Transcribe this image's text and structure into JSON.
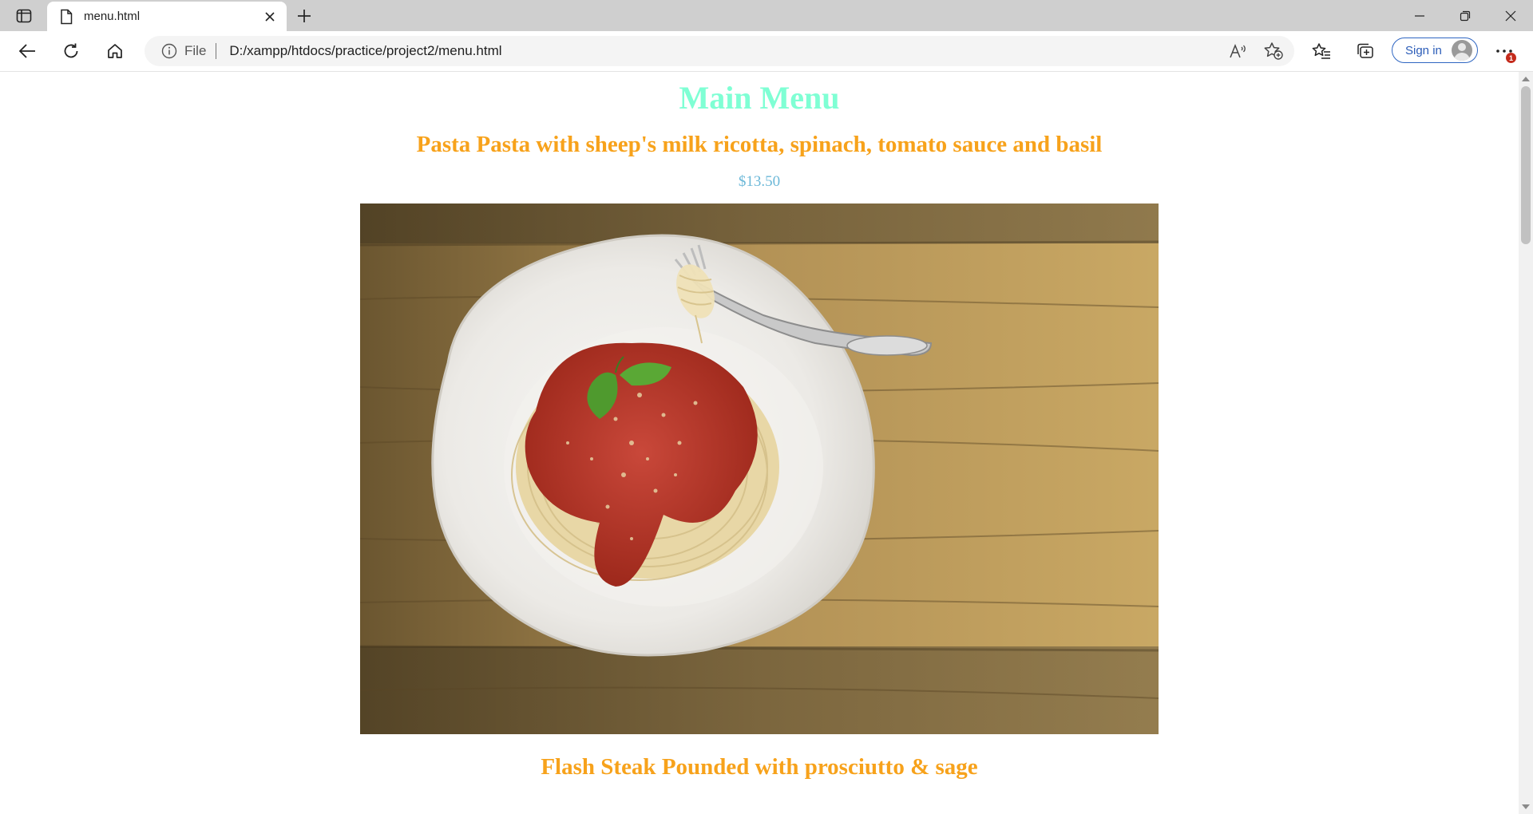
{
  "browser": {
    "tab": {
      "title": "menu.html"
    },
    "address_bar": {
      "scheme_label": "File",
      "url": "D:/xampp/htdocs/practice/project2/menu.html"
    },
    "signin_label": "Sign in",
    "notification_count": "1",
    "accent_color": "#2b5cb8"
  },
  "page": {
    "title": "Main Menu",
    "title_color": "#7fffd4",
    "dish_color": "#f7a21b",
    "price_color": "#6cb8d8",
    "dishes": [
      {
        "name": "Pasta Pasta with sheep's milk ricotta, spinach, tomato sauce and basil",
        "price": "$13.50",
        "image": "spaghetti-with-tomato-sauce-and-basil-on-wooden-table"
      },
      {
        "name": "Flash Steak Pounded with prosciutto & sage"
      }
    ]
  }
}
